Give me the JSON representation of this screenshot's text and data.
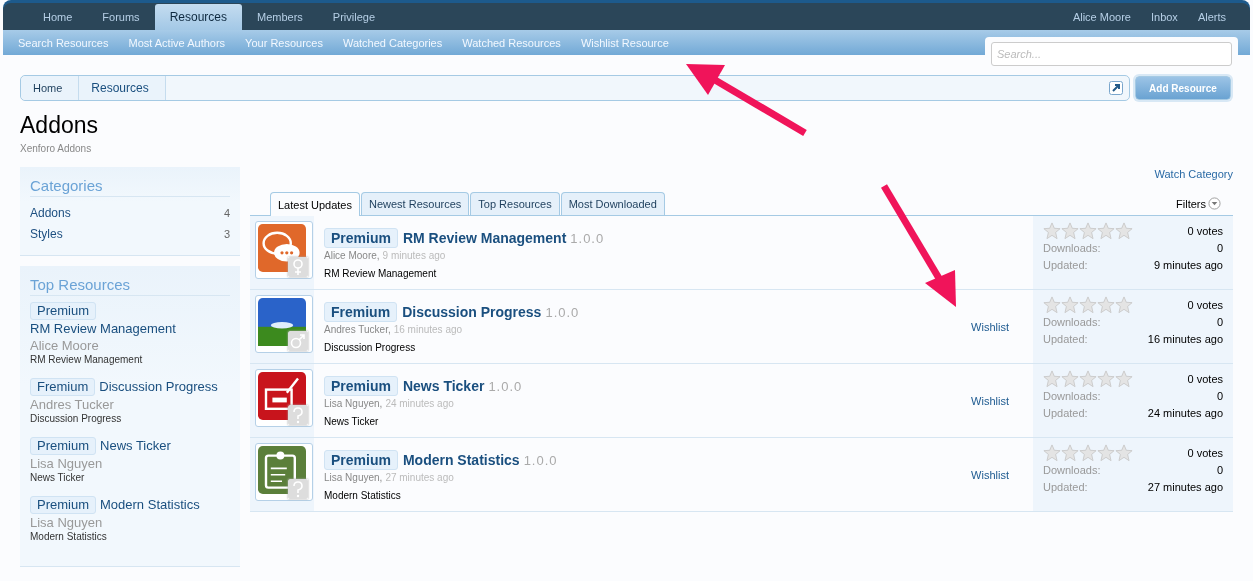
{
  "nav": {
    "tabs": [
      {
        "label": "Home",
        "selected": false
      },
      {
        "label": "Forums",
        "selected": false
      },
      {
        "label": "Resources",
        "selected": true
      },
      {
        "label": "Members",
        "selected": false
      },
      {
        "label": "Privilege",
        "selected": false
      }
    ],
    "user_links": [
      "Alice Moore",
      "Inbox",
      "Alerts"
    ]
  },
  "subnav": {
    "links": [
      "Search Resources",
      "Most Active Authors",
      "Your Resources",
      "Watched Categories",
      "Watched Resources",
      "Wishlist Resource"
    ]
  },
  "search": {
    "placeholder": "Search..."
  },
  "breadcrumb": [
    "Home",
    "Resources"
  ],
  "add_button": "Add Resource",
  "title": "Addons",
  "description": "Xenforo Addons",
  "categories": {
    "title": "Categories",
    "items": [
      {
        "label": "Addons",
        "count": "4"
      },
      {
        "label": "Styles",
        "count": "3"
      }
    ]
  },
  "top_resources": {
    "title": "Top Resources",
    "items": [
      {
        "prefix": "Premium",
        "title": "RM Review Management",
        "author": "Alice Moore",
        "tagline": "RM Review Management"
      },
      {
        "prefix": "Fremium",
        "title": "Discussion Progress",
        "author": "Andres Tucker",
        "tagline": "Discussion Progress"
      },
      {
        "prefix": "Premium",
        "title": "News Ticker",
        "author": "Lisa Nguyen",
        "tagline": "News Ticker"
      },
      {
        "prefix": "Premium",
        "title": "Modern Statistics",
        "author": "Lisa Nguyen",
        "tagline": "Modern Statistics"
      }
    ]
  },
  "watch_category": "Watch Category",
  "tabs": [
    {
      "label": "Latest Updates",
      "selected": true
    },
    {
      "label": "Newest Resources",
      "selected": false
    },
    {
      "label": "Top Resources",
      "selected": false
    },
    {
      "label": "Most Downloaded",
      "selected": false
    }
  ],
  "filters": "Filters",
  "resources": [
    {
      "kind": "chat",
      "prefix": "Premium",
      "title": "RM Review Management",
      "version": "1.0.0",
      "author": "Alice Moore,",
      "time": "9 minutes ago",
      "tagline": "RM Review Management",
      "stars": 0,
      "votes": "0 votes",
      "downloads_label": "Downloads:",
      "downloads": "0",
      "updated_label": "Updated:",
      "updated": "9 minutes ago"
    },
    {
      "kind": "landscape",
      "prefix": "Fremium",
      "title": "Discussion Progress",
      "version": "1.0.0",
      "author": "Andres Tucker,",
      "time": "16 minutes ago",
      "tagline": "Discussion Progress",
      "wishlist": "Wishlist",
      "stars": 0,
      "votes": "0 votes",
      "downloads_label": "Downloads:",
      "downloads": "0",
      "updated_label": "Updated:",
      "updated": "16 minutes ago"
    },
    {
      "kind": "news",
      "prefix": "Premium",
      "title": "News Ticker",
      "version": "1.0.0",
      "author": "Lisa Nguyen,",
      "time": "24 minutes ago",
      "tagline": "News Ticker",
      "wishlist": "Wishlist",
      "stars": 0,
      "votes": "0 votes",
      "downloads_label": "Downloads:",
      "downloads": "0",
      "updated_label": "Updated:",
      "updated": "24 minutes ago"
    },
    {
      "kind": "clipboard",
      "prefix": "Premium",
      "title": "Modern Statistics",
      "version": "1.0.0",
      "author": "Lisa Nguyen,",
      "time": "27 minutes ago",
      "tagline": "Modern Statistics",
      "wishlist": "Wishlist",
      "stars": 0,
      "votes": "0 votes",
      "downloads_label": "Downloads:",
      "downloads": "0",
      "updated_label": "Updated:",
      "updated": "27 minutes ago"
    }
  ]
}
